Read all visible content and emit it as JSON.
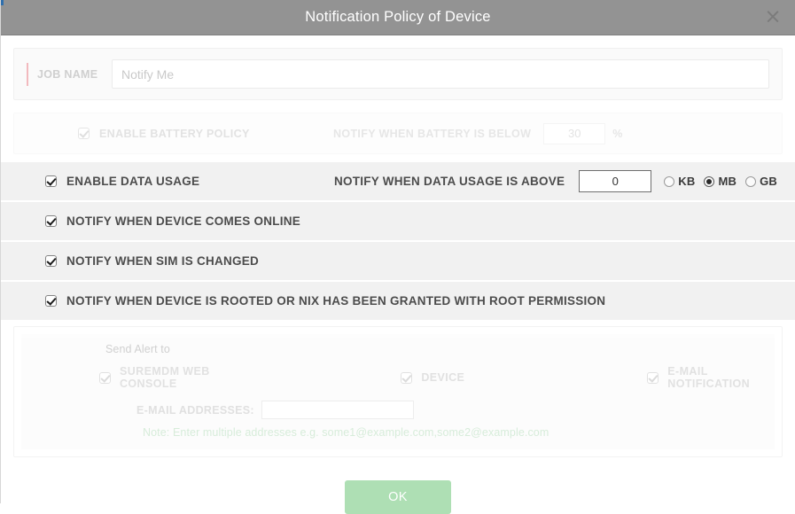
{
  "dialog": {
    "title": "Notification Policy of Device",
    "close_label": "×"
  },
  "job_name": {
    "label": "JOB NAME",
    "placeholder": "Notify Me",
    "value": ""
  },
  "battery_policy": {
    "checkbox_label": "ENABLE BATTERY POLICY",
    "checked": true,
    "threshold_caption": "NOTIFY WHEN BATTERY IS BELOW",
    "threshold_value": "30",
    "unit": "%"
  },
  "data_usage": {
    "checkbox_label": "ENABLE DATA USAGE",
    "checked": true,
    "threshold_caption": "NOTIFY WHEN DATA USAGE IS ABOVE",
    "threshold_value": "0",
    "units": [
      {
        "label": "KB",
        "selected": false
      },
      {
        "label": "MB",
        "selected": true
      },
      {
        "label": "GB",
        "selected": false
      }
    ]
  },
  "options": [
    {
      "label": "NOTIFY WHEN DEVICE COMES ONLINE",
      "checked": true
    },
    {
      "label": "NOTIFY WHEN SIM IS CHANGED",
      "checked": true
    },
    {
      "label": "NOTIFY WHEN DEVICE IS ROOTED OR NIX HAS BEEN GRANTED WITH ROOT PERMISSION",
      "checked": true
    }
  ],
  "send_alert": {
    "title": "Send Alert to",
    "targets": [
      {
        "label": "SUREMDM WEB CONSOLE",
        "checked": true
      },
      {
        "label": "DEVICE",
        "checked": true
      },
      {
        "label": "E-MAIL NOTIFICATION",
        "checked": true
      }
    ],
    "email_label": "E-MAIL ADDRESSES:",
    "email_value": "",
    "note": "Note: Enter multiple addresses e.g. some1@example.com,some2@example.com"
  },
  "footer": {
    "ok_label": "OK"
  },
  "colors": {
    "titlebar": "#939393",
    "ok_button": "#aedfb4",
    "row_band": "#f1f1f1",
    "accent_red": "#f2b9be",
    "note_green": "#bfe2c4"
  }
}
